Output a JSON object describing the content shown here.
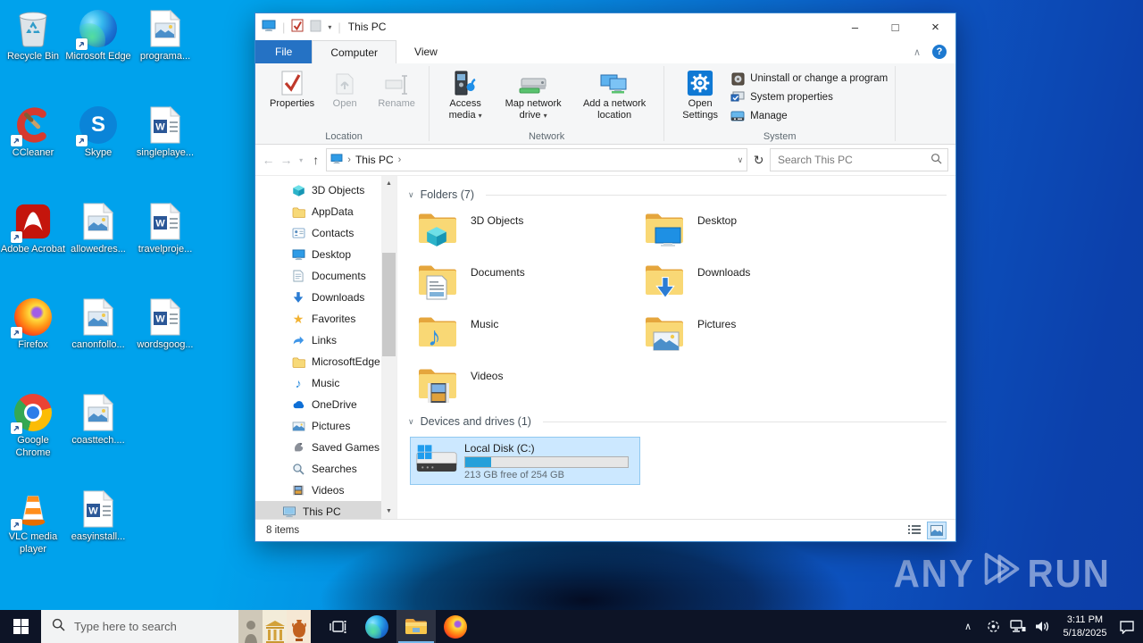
{
  "watermark": {
    "brand_left": "ANY",
    "brand_right": "RUN"
  },
  "icons": {
    "minimize": "–",
    "maximize": "□",
    "close": "×",
    "help": "?",
    "ribbon_collapse": "∧",
    "back": "←",
    "forward": "→",
    "up": "↑",
    "refresh": "↻",
    "dropdown": "▾",
    "chevron_small": "∨",
    "breadcrumb_sep": "›",
    "section_chevron": "∨",
    "tray_chevron": "∧",
    "scroll_up": "▲",
    "scroll_down": "▼",
    "star": "★",
    "note": "♪"
  },
  "desktop": {
    "icons": [
      {
        "label": "Recycle Bin"
      },
      {
        "label": "Microsoft Edge"
      },
      {
        "label": "programa..."
      },
      {
        "label": "CCleaner"
      },
      {
        "label": "Skype"
      },
      {
        "label": "singleplaye..."
      },
      {
        "label": "Adobe Acrobat"
      },
      {
        "label": "allowedres..."
      },
      {
        "label": "travelproje..."
      },
      {
        "label": "Firefox"
      },
      {
        "label": "canonfollo..."
      },
      {
        "label": "wordsgoog..."
      },
      {
        "label": "Google Chrome"
      },
      {
        "label": "coasttech...."
      },
      {
        "label": "VLC media player"
      },
      {
        "label": "easyinstall..."
      }
    ]
  },
  "explorer": {
    "title": "This PC",
    "tabs": {
      "file": "File",
      "computer": "Computer",
      "view": "View"
    },
    "ribbon": {
      "properties": "Properties",
      "open": "Open",
      "rename": "Rename",
      "location_group": "Location",
      "access_media": "Access media",
      "map_network_drive": "Map network drive",
      "add_network_location": "Add a network location",
      "network_group": "Network",
      "open_settings": "Open Settings",
      "uninstall": "Uninstall or change a program",
      "system_properties": "System properties",
      "manage": "Manage",
      "system_group": "System"
    },
    "address": {
      "breadcrumb": "This PC",
      "search_placeholder": "Search This PC"
    },
    "nav": {
      "items": [
        {
          "label": "3D Objects"
        },
        {
          "label": "AppData"
        },
        {
          "label": "Contacts"
        },
        {
          "label": "Desktop"
        },
        {
          "label": "Documents"
        },
        {
          "label": "Downloads"
        },
        {
          "label": "Favorites"
        },
        {
          "label": "Links"
        },
        {
          "label": "MicrosoftEdge"
        },
        {
          "label": "Music"
        },
        {
          "label": "OneDrive"
        },
        {
          "label": "Pictures"
        },
        {
          "label": "Saved Games"
        },
        {
          "label": "Searches"
        },
        {
          "label": "Videos"
        },
        {
          "label": "This PC"
        }
      ]
    },
    "folders_section": {
      "title": "Folders (7)",
      "tiles": [
        {
          "label": "3D Objects"
        },
        {
          "label": "Desktop"
        },
        {
          "label": "Documents"
        },
        {
          "label": "Downloads"
        },
        {
          "label": "Music"
        },
        {
          "label": "Pictures"
        },
        {
          "label": "Videos"
        }
      ]
    },
    "devices_section": {
      "title": "Devices and drives (1)",
      "drive": {
        "name": "Local Disk (C:)",
        "free_text": "213 GB free of 254 GB",
        "used_percent": 16
      }
    },
    "status": {
      "items_text": "8 items"
    }
  },
  "taskbar": {
    "search_placeholder": "Type here to search",
    "clock": {
      "time": "3:11 PM",
      "date": "5/18/2025"
    }
  },
  "colors": {
    "accent_blue": "#0078d7",
    "file_tab_blue": "#2572c4",
    "selection_blue": "#cce8ff",
    "usage_bar_blue": "#26a0da",
    "desktop_cyan": "#00a2ec",
    "desktop_royal": "#0c40ab",
    "taskbar_dark": "#0d1426"
  }
}
